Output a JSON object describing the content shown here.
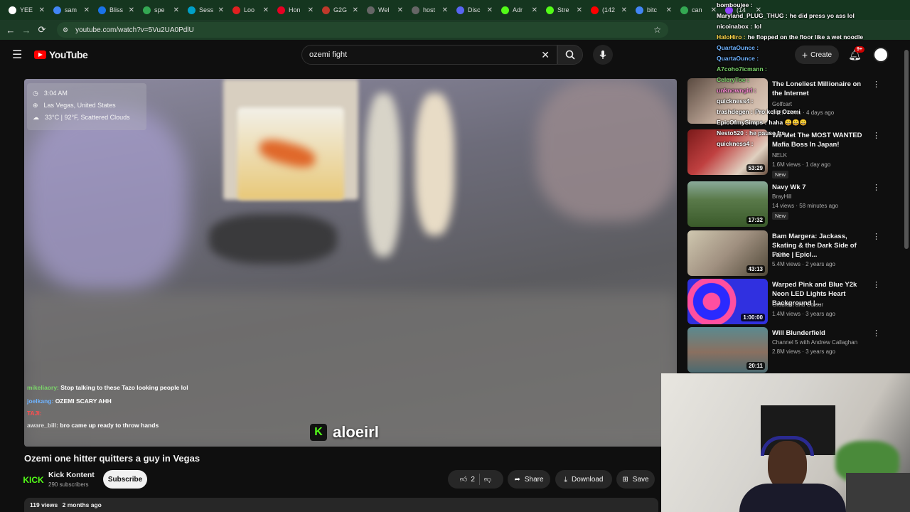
{
  "browser": {
    "tabs": [
      "YEE",
      "sam",
      "Bliss",
      "spe",
      "Sess",
      "Loo",
      "Hon",
      "G2G",
      "Wel",
      "host",
      "Disc",
      "Adr",
      "Stre",
      "(142",
      "bitc",
      "can",
      "(14"
    ],
    "tab_colors": [
      "#ffffff",
      "#4285f4",
      "#1a73e8",
      "#34a853",
      "#00a0c8",
      "#e02020",
      "#e60023",
      "#c0392b",
      "#666666",
      "#666666",
      "#5865f2",
      "#53fc18",
      "#53fc18",
      "#ff0000",
      "#4285f4",
      "#34a853",
      "#9146ff"
    ],
    "url": "youtube.com/watch?v=5Vu2UA0PdlU"
  },
  "youtube": {
    "logo_text": "YouTube",
    "search_value": "ozemi fight",
    "create_label": "Create",
    "notif_count": "9+"
  },
  "video_overlay": {
    "time": "3:04 AM",
    "location": "Las Vegas, United States",
    "weather": "33°C | 92°F, Scattered Clouds",
    "watermark": "aloeirl",
    "chat": [
      {
        "user": "mikeliaory:",
        "msg": "Stop talking to these Tazo looking people lol",
        "color": "#7bd36a"
      },
      {
        "user": "joelkang:",
        "msg": "OZEMI SCARY AHH",
        "color": "#6fb3ff"
      },
      {
        "user": "TAJI:",
        "msg": "",
        "color": "#ff4f4f"
      },
      {
        "user": "aware_bill:",
        "msg": "bro came up ready to throw hands",
        "color": "#cfcfcf"
      }
    ]
  },
  "video": {
    "title": "Ozemi one hitter quitters a guy in Vegas",
    "channel": "Kick Kontent",
    "subscribers": "290 subscribers",
    "subscribe_label": "Subscribe",
    "likes": "2",
    "share_label": "Share",
    "download_label": "Download",
    "save_label": "Save",
    "views": "119 views",
    "age": "2 months ago"
  },
  "recommendations": [
    {
      "title": "The Loneliest Millionaire on the Internet",
      "channel": "Golfcart",
      "meta": "242K views · 4 days ago",
      "duration": "",
      "badge": "",
      "thumb": "#b8a8a0"
    },
    {
      "title": "We Met The MOST WANTED Mafia Boss In Japan!",
      "channel": "NELK",
      "meta": "1.6M views · 1 day ago",
      "duration": "53:29",
      "badge": "New",
      "thumb": "#8a2a2a"
    },
    {
      "title": "Navy Wk 7",
      "channel": "BrayHill",
      "meta": "14 views · 58 minutes ago",
      "duration": "17:32",
      "badge": "New",
      "thumb": "#4a6a3a"
    },
    {
      "title": "Bam Margera: Jackass, Skating & the Dark Side of Fame | Epicl...",
      "channel": "VICE",
      "meta": "5.4M views · 2 years ago",
      "duration": "43:13",
      "badge": "",
      "thumb": "#8a8070"
    },
    {
      "title": "Warped Pink and Blue Y2k Neon LED Lights Heart Background |...",
      "channel": "Gradient and Colour",
      "meta": "1.4M views · 3 years ago",
      "duration": "1:00:00",
      "badge": "",
      "thumb": "#3a3ad8"
    },
    {
      "title": "Will Blunderfield",
      "channel": "Channel 5 with Andrew Callaghan",
      "meta": "2.8M views · 3 years ago",
      "duration": "20:11",
      "badge": "",
      "thumb": "#6a8a8a"
    }
  ],
  "stream_chat": [
    {
      "user": "bomboujee :",
      "msg": "",
      "color": "#ffffff"
    },
    {
      "user": "Maryland_PLUG_THUG :",
      "msg": "he did press yo ass lol",
      "color": "#ffffff"
    },
    {
      "user": "nicoinabox :",
      "msg": "lol",
      "color": "#ffffff"
    },
    {
      "user": "HaloHiro :",
      "msg": "he flopped on the floor like a wet noodle",
      "color": "#ffd84a"
    },
    {
      "user": "QuartaOunce :",
      "msg": "",
      "color": "#6fb3ff"
    },
    {
      "user": "QuartaOunce :",
      "msg": "",
      "color": "#6fb3ff"
    },
    {
      "user": "A7coho7icmann :",
      "msg": "",
      "color": "#7bd36a"
    },
    {
      "user": "CeleryToe :",
      "msg": "",
      "color": "#7bd36a"
    },
    {
      "user": "unknowngirl :",
      "msg": "",
      "color": "#ff8ad8"
    },
    {
      "user": "quickness4 :",
      "msg": "",
      "color": "#ffffff"
    },
    {
      "user": "trashdegen :",
      "msg": "Pro kclip Ozemi",
      "color": "#ffffff"
    },
    {
      "user": "EpicOfmySimps :",
      "msg": "haha 😀😀😀",
      "color": "#ffffff"
    },
    {
      "user": "Nesto520 :",
      "msg": "he pause frs",
      "color": "#ffffff"
    },
    {
      "user": "quickness4 :",
      "msg": "",
      "color": "#ffffff"
    }
  ]
}
